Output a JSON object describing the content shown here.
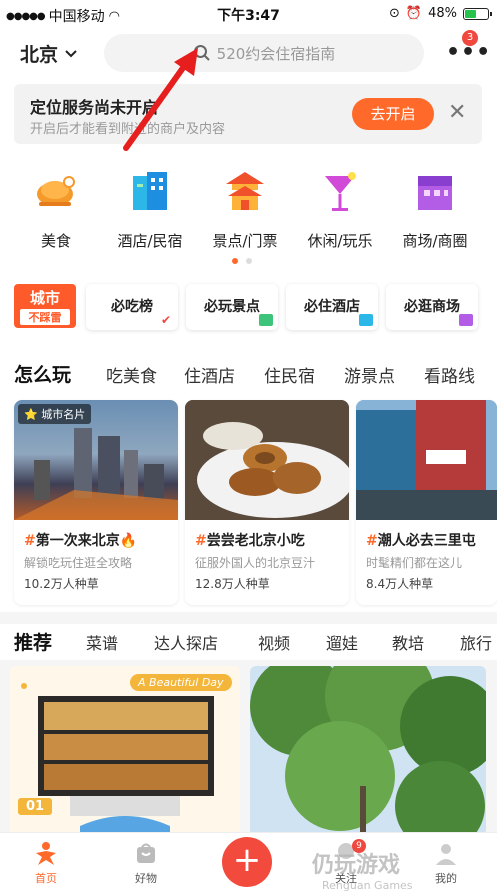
{
  "status": {
    "carrier": "中国移动",
    "time": "下午3:47",
    "battery": "48%",
    "battery_level": 0.48
  },
  "header": {
    "city": "北京",
    "search_placeholder": "520约会住宿指南",
    "notif_count": "3",
    "more": "•••"
  },
  "location_banner": {
    "title": "定位服务尚未开启",
    "subtitle": "开启后才能看到附近的商户及内容",
    "button": "去开启"
  },
  "categories": [
    {
      "label": "美食",
      "icon": "chicken-icon"
    },
    {
      "label": "酒店/民宿",
      "icon": "building-icon"
    },
    {
      "label": "景点/门票",
      "icon": "pagoda-icon"
    },
    {
      "label": "休闲/玩乐",
      "icon": "cocktail-icon"
    },
    {
      "label": "商场/商圈",
      "icon": "mall-icon"
    }
  ],
  "city_tag": {
    "line1": "城市",
    "line2": "不踩雷"
  },
  "chips": [
    "必吃榜",
    "必玩景点",
    "必住酒店",
    "必逛商场"
  ],
  "play_tabs": [
    "怎么玩",
    "吃美食",
    "住酒店",
    "住民宿",
    "游景点",
    "看路线"
  ],
  "cards": [
    {
      "badge": "城市名片",
      "hash": "#",
      "title": "第一次来北京🔥",
      "sub": "解锁吃玩住逛全攻略",
      "count": "10.2万人种草"
    },
    {
      "hash": "#",
      "title": "尝尝老北京小吃",
      "sub": "征服外国人的北京豆汁",
      "count": "12.8万人种草"
    },
    {
      "hash": "#",
      "title": "潮人必去三里屯",
      "sub": "时髦精们都在这儿",
      "count": "8.4万人种草"
    }
  ],
  "rec_tabs": [
    "推荐",
    "菜谱",
    "达人探店",
    "视频",
    "遛娃",
    "教培",
    "旅行"
  ],
  "feed": {
    "badge": "A Beautiful Day",
    "number": "01"
  },
  "bottom": {
    "home": "首页",
    "goods": "好物",
    "follow": "关注",
    "mine": "我的",
    "plus": "+",
    "follow_badge": "9"
  },
  "watermark": {
    "line1": "仍玩游戏",
    "line2": "Renguan Games"
  },
  "colors": {
    "accent": "#ff6a2a",
    "red": "#f34a3e"
  }
}
